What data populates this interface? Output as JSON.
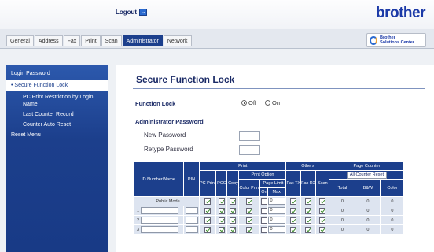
{
  "header": {
    "logout_label": "Logout",
    "brand": "brother"
  },
  "tabs": [
    {
      "label": "General"
    },
    {
      "label": "Address"
    },
    {
      "label": "Fax"
    },
    {
      "label": "Print"
    },
    {
      "label": "Scan"
    },
    {
      "label": "Administrator",
      "active": true
    },
    {
      "label": "Network"
    }
  ],
  "solutions": {
    "line1": "Brother",
    "line2": "Solutions Center"
  },
  "sidebar": {
    "items": [
      {
        "label": "Login Password",
        "level": 0
      },
      {
        "label": "• Secure Function Lock",
        "level": 0,
        "selected": true
      },
      {
        "label": "PC Print Restriction by Login Name",
        "level": 1
      },
      {
        "label": "Last Counter Record",
        "level": 1
      },
      {
        "label": "Counter Auto Reset",
        "level": 1
      },
      {
        "label": "Reset Menu",
        "level": 0
      }
    ]
  },
  "main": {
    "title": "Secure Function Lock",
    "function_lock": {
      "label": "Function Lock",
      "off": "Off",
      "on": "On",
      "selected": "off"
    },
    "admin_password": {
      "heading": "Administrator Password",
      "new_label": "New Password",
      "retype_label": "Retype Password"
    }
  },
  "table": {
    "headers": {
      "id_name": "ID Number/Name",
      "pin": "PIN",
      "print": "Print",
      "print_option": "Print Option",
      "page_limit": "Page Limit",
      "pc_print": "PC Print",
      "pcc": "PCC",
      "copy": "Copy",
      "color_print": "Color Print",
      "on": "On",
      "max": "Max.",
      "others": "Others",
      "fax_tx": "Fax TX",
      "fax_rx": "Fax RX",
      "scan": "Scan",
      "page_counter": "Page Counter",
      "all_counter_reset": "All Counter Reset",
      "total": "Total",
      "bw": "B&W",
      "color": "Color"
    },
    "rows": [
      {
        "label": "Public Mode",
        "limit": "0",
        "total": "0",
        "bw": "0",
        "color": "0"
      },
      {
        "label": "1",
        "limit": "0",
        "total": "0",
        "bw": "0",
        "color": "0"
      },
      {
        "label": "2",
        "limit": "0",
        "total": "0",
        "bw": "0",
        "color": "0"
      },
      {
        "label": "3",
        "limit": "0",
        "total": "0",
        "bw": "0",
        "color": "0"
      }
    ]
  }
}
